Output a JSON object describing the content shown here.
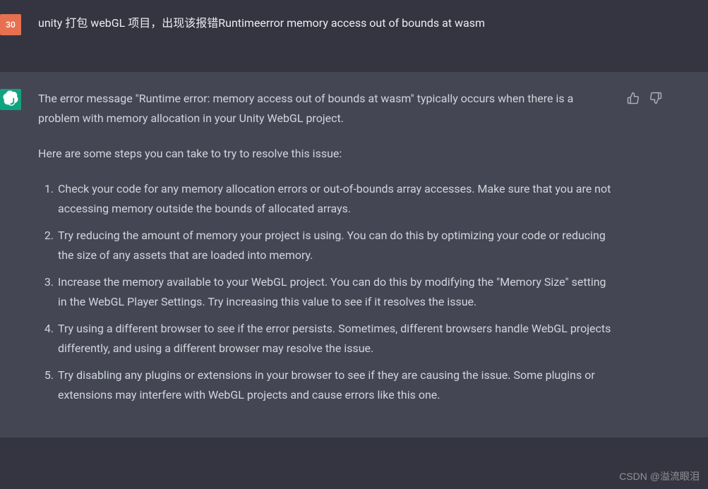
{
  "user": {
    "avatar_label": "30",
    "message": "unity  打包 webGL 项目，出现该报错Runtimeerror memory access out of bounds  at wasm"
  },
  "assistant": {
    "paragraph1": "The error message \"Runtime error: memory access out of bounds at wasm\" typically occurs when there is a problem with memory allocation in your Unity WebGL project.",
    "paragraph2": "Here are some steps you can take to try to resolve this issue:",
    "steps": [
      "Check your code for any memory allocation errors or out-of-bounds array accesses. Make sure that you are not accessing memory outside the bounds of allocated arrays.",
      "Try reducing the amount of memory your project is using. You can do this by optimizing your code or reducing the size of any assets that are loaded into memory.",
      "Increase the memory available to your WebGL project. You can do this by modifying the \"Memory Size\" setting in the WebGL Player Settings. Try increasing this value to see if it resolves the issue.",
      "Try using a different browser to see if the error persists. Sometimes, different browsers handle WebGL projects differently, and using a different browser may resolve the issue.",
      "Try disabling any plugins or extensions in your browser to see if they are causing the issue. Some plugins or extensions may interfere with WebGL projects and cause errors like this one."
    ]
  },
  "watermark": "CSDN @溢流眼泪"
}
